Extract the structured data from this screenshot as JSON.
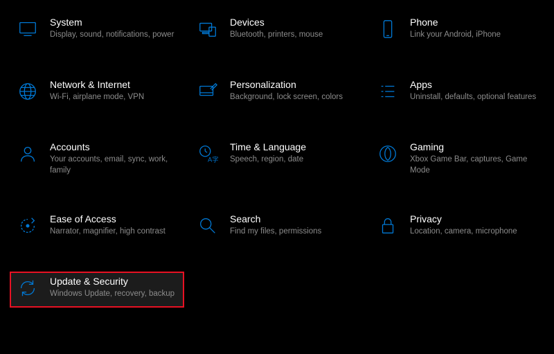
{
  "tiles": [
    {
      "id": "system",
      "title": "System",
      "desc": "Display, sound, notifications, power"
    },
    {
      "id": "devices",
      "title": "Devices",
      "desc": "Bluetooth, printers, mouse"
    },
    {
      "id": "phone",
      "title": "Phone",
      "desc": "Link your Android, iPhone"
    },
    {
      "id": "network",
      "title": "Network & Internet",
      "desc": "Wi-Fi, airplane mode, VPN"
    },
    {
      "id": "personalization",
      "title": "Personalization",
      "desc": "Background, lock screen, colors"
    },
    {
      "id": "apps",
      "title": "Apps",
      "desc": "Uninstall, defaults, optional features"
    },
    {
      "id": "accounts",
      "title": "Accounts",
      "desc": "Your accounts, email, sync, work, family"
    },
    {
      "id": "time-language",
      "title": "Time & Language",
      "desc": "Speech, region, date"
    },
    {
      "id": "gaming",
      "title": "Gaming",
      "desc": "Xbox Game Bar, captures, Game Mode"
    },
    {
      "id": "ease-of-access",
      "title": "Ease of Access",
      "desc": "Narrator, magnifier, high contrast"
    },
    {
      "id": "search",
      "title": "Search",
      "desc": "Find my files, permissions"
    },
    {
      "id": "privacy",
      "title": "Privacy",
      "desc": "Location, camera, microphone"
    },
    {
      "id": "update-security",
      "title": "Update & Security",
      "desc": "Windows Update, recovery, backup",
      "selected": true
    }
  ]
}
